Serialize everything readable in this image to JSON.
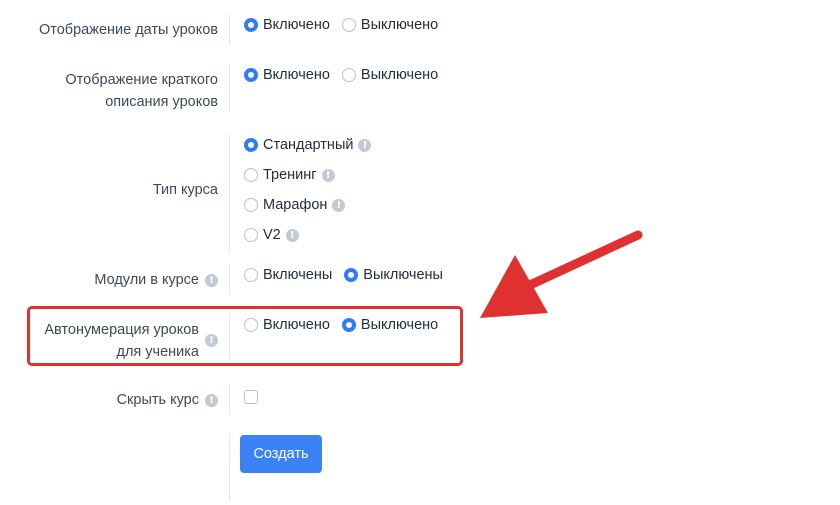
{
  "settings": {
    "lesson_date": {
      "label": "Отображение даты уроков",
      "options": [
        "Включено",
        "Выключено"
      ],
      "selected": "Включено"
    },
    "short_description": {
      "label_line1": "Отображение краткого",
      "label_line2": "описания уроков",
      "options": [
        "Включено",
        "Выключено"
      ],
      "selected": "Включено"
    },
    "course_type": {
      "label": "Тип курса",
      "options": [
        "Стандартный",
        "Тренинг",
        "Марафон",
        "V2"
      ],
      "selected": "Стандартный"
    },
    "modules": {
      "label": "Модули в курсе",
      "options": [
        "Включены",
        "Выключены"
      ],
      "selected": "Выключены"
    },
    "autonumbering": {
      "label_line1": "Автонумерация уроков",
      "label_line2": "для ученика",
      "options": [
        "Включено",
        "Выключено"
      ],
      "selected": "Выключено"
    },
    "hide_course": {
      "label": "Скрыть курс",
      "checked": false
    }
  },
  "create_button": "Создать",
  "info_glyph": "!",
  "colors": {
    "accent": "#3b82f6",
    "highlight": "#e03131"
  }
}
